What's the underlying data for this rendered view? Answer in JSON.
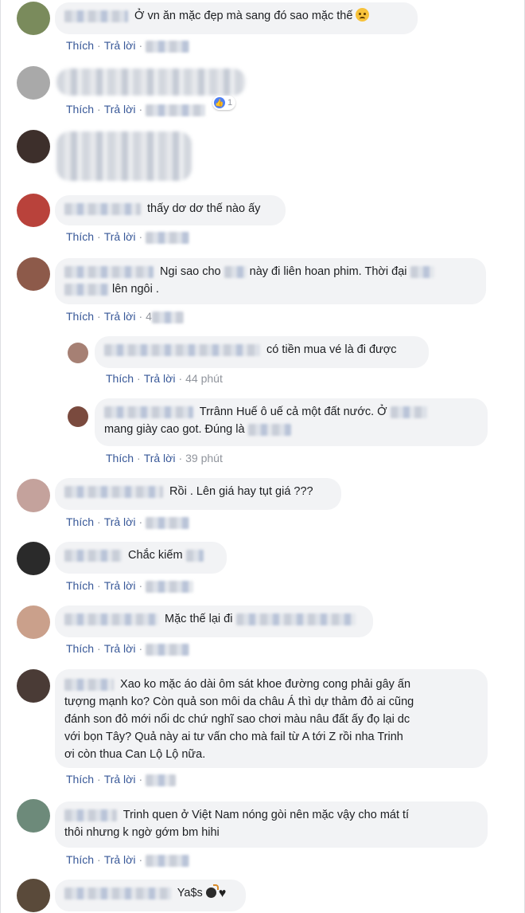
{
  "actions": {
    "like": "Thích",
    "reply": "Trả lời"
  },
  "comments": [
    {
      "text": "Ở vn ăn mặc đẹp mà sang đó sao mặc thế",
      "avatar_color": "#7a8b5c"
    },
    {
      "text": "",
      "avatar_color": "#a9a9a9",
      "reaction_count": "1"
    },
    {
      "text": "",
      "avatar_color": "#3d2f2b"
    },
    {
      "text": "thấy dơ dơ thế nào ấy",
      "avatar_color": "#b9423b"
    },
    {
      "line1": "Ngi sao cho",
      "line1b": "này đi liên hoan phim. Thời đại",
      "line2": "lên ngôi .",
      "time_prefix": "4",
      "avatar_color": "#8d5a4a"
    },
    {
      "text": "có tiền mua vé là đi được",
      "time": "44 phút",
      "avatar_color": "#a68074"
    },
    {
      "line1": "Trrânn Huế ô uế cả một đất nước. Ở",
      "line2": "mang giày cao got. Đúng là",
      "time": "39 phút",
      "avatar_color": "#7a4a3e"
    },
    {
      "text": "Rồi . Lên giá hay tụt giá ???",
      "avatar_color": "#c4a29c"
    },
    {
      "text": "Chắc kiếm",
      "avatar_color": "#2a2a2a"
    },
    {
      "text": "Mặc thế lại đi",
      "avatar_color": "#caa08b"
    },
    {
      "lines": [
        "Xao ko mặc áo dài ôm sát khoe đường cong phải gây ấn",
        "tượng mạnh ko? Còn quả son môi da châu Á thì dự thảm đỏ ai cũng",
        "đánh son đỏ mới nổi dc chứ nghĩ sao chơi màu nâu đất ấy đọ lại dc",
        "với bọn Tây? Quả này ai tư vấn cho mà fail từ A tới Z rồi nha Trinh",
        "ơi còn thua Can Lộ Lộ nữa."
      ],
      "avatar_color": "#4a3b36"
    },
    {
      "lines": [
        "Trinh quen ở Việt Nam nóng gòi nên mặc vậy cho mát tí",
        "thôi nhưng k ngờ gớm bm hihi"
      ],
      "avatar_color": "#6d8a7a"
    },
    {
      "text": "Ya$s",
      "avatar_color": "#5a4a3a"
    }
  ],
  "icons": {
    "sad_emoji": "sad-face-emoji",
    "bomb": "bomb-emoji",
    "heart": "black-heart-emoji",
    "like": "like-icon"
  }
}
